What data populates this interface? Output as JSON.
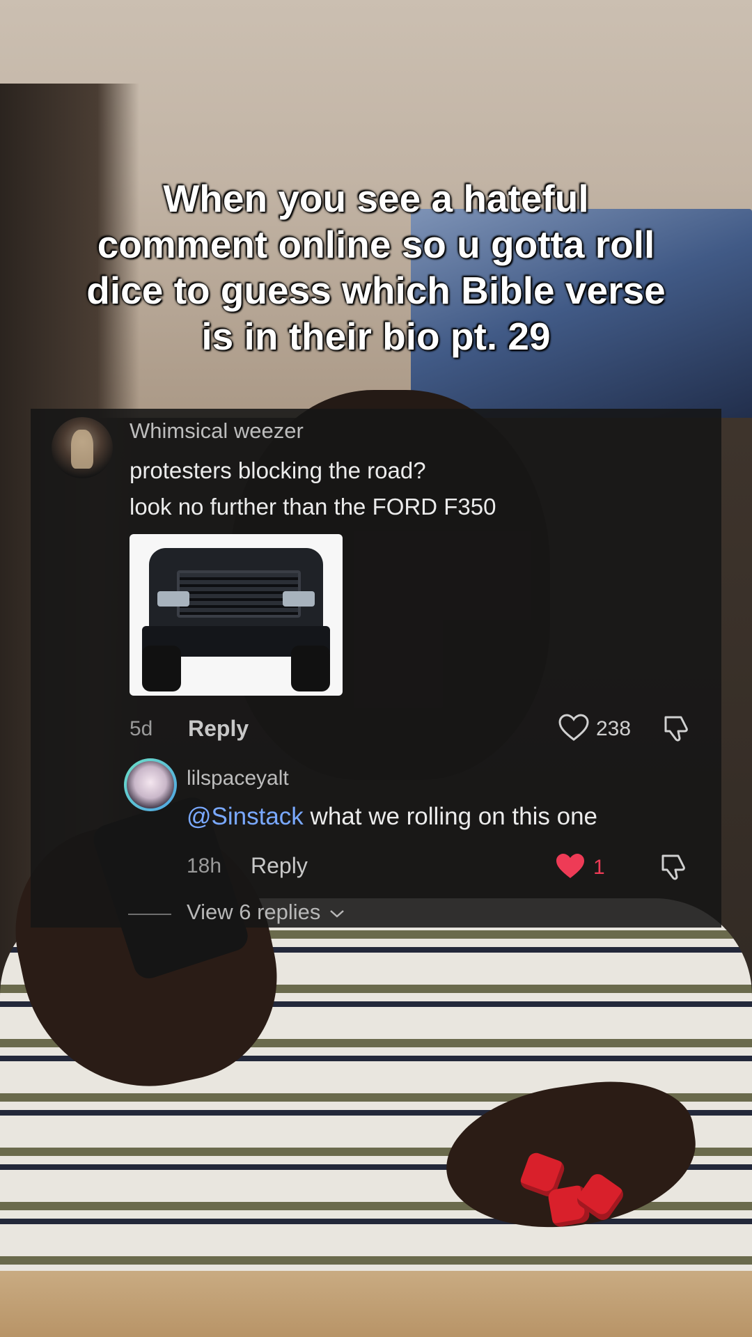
{
  "caption": {
    "text": "When you see a hateful\ncomment online so u gotta roll\ndice to guess which Bible verse\nis in their bio pt. 29"
  },
  "comment": {
    "username": "Whimsical weezer",
    "text": "protesters blocking the road?\nlook no further than the FORD F350",
    "age": "5d",
    "reply_label": "Reply",
    "likes": "238",
    "icons": {
      "like": "heart-outline-icon",
      "dislike": "thumbs-down-icon"
    }
  },
  "reply": {
    "username": "lilspaceyalt",
    "mention": "@Sinstack",
    "text": " what we rolling on this one",
    "age": "18h",
    "reply_label": "Reply",
    "likes": "1",
    "liked": true,
    "icons": {
      "like": "heart-filled-icon",
      "dislike": "thumbs-down-icon"
    }
  },
  "view_replies": {
    "label": "View 6 replies",
    "icon": "chevron-down-icon"
  },
  "colors": {
    "mention": "#7aa9ff",
    "liked_heart": "#ee3b56",
    "panel_bg": "#161616"
  }
}
